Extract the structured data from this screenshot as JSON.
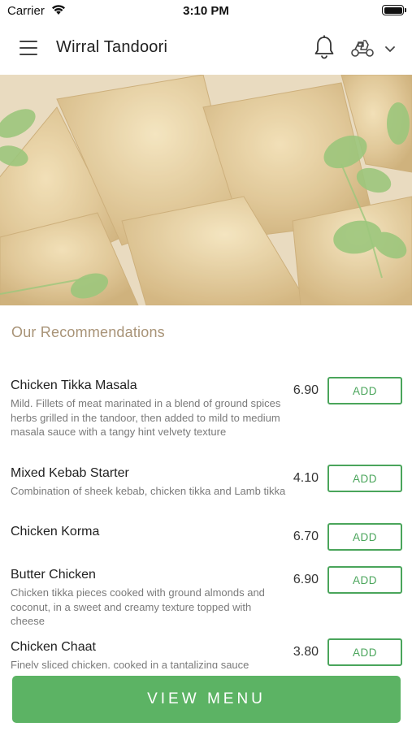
{
  "status_bar": {
    "carrier": "Carrier",
    "time": "3:10 PM"
  },
  "header": {
    "title": "Wirral Tandoori",
    "icons": [
      "menu-icon",
      "bell-icon",
      "scooter-icon",
      "chevron-down-icon"
    ]
  },
  "hero": {
    "image": "samosas-with-coriander-photo"
  },
  "recommendations": {
    "title": "Our Recommendations",
    "add_label": "ADD",
    "items": [
      {
        "name": "Chicken Tikka Masala",
        "description": "Mild. Fillets of meat marinated in a blend of ground spices herbs grilled in the tandoor, then added to mild to medium masala sauce with a tangy hint velvety texture",
        "price": "6.90"
      },
      {
        "name": "Mixed Kebab Starter",
        "description": "Combination of sheek kebab, chicken tikka and Lamb tikka",
        "price": "4.10"
      },
      {
        "name": "Chicken Korma",
        "description": "",
        "price": "6.70"
      },
      {
        "name": "Butter Chicken",
        "description": "Chicken tikka pieces cooked with ground almonds and coconut, in a sweet and creamy texture topped with cheese",
        "price": "6.90"
      },
      {
        "name": "Chicken Chaat",
        "description": "Finely sliced chicken, cooked in a tantalizing sauce",
        "price": "3.80"
      }
    ]
  },
  "footer": {
    "view_menu_label": "VIEW MENU"
  },
  "colors": {
    "accent_green": "#4aa55b",
    "button_green": "#5cb364",
    "section_title": "#a89377"
  }
}
